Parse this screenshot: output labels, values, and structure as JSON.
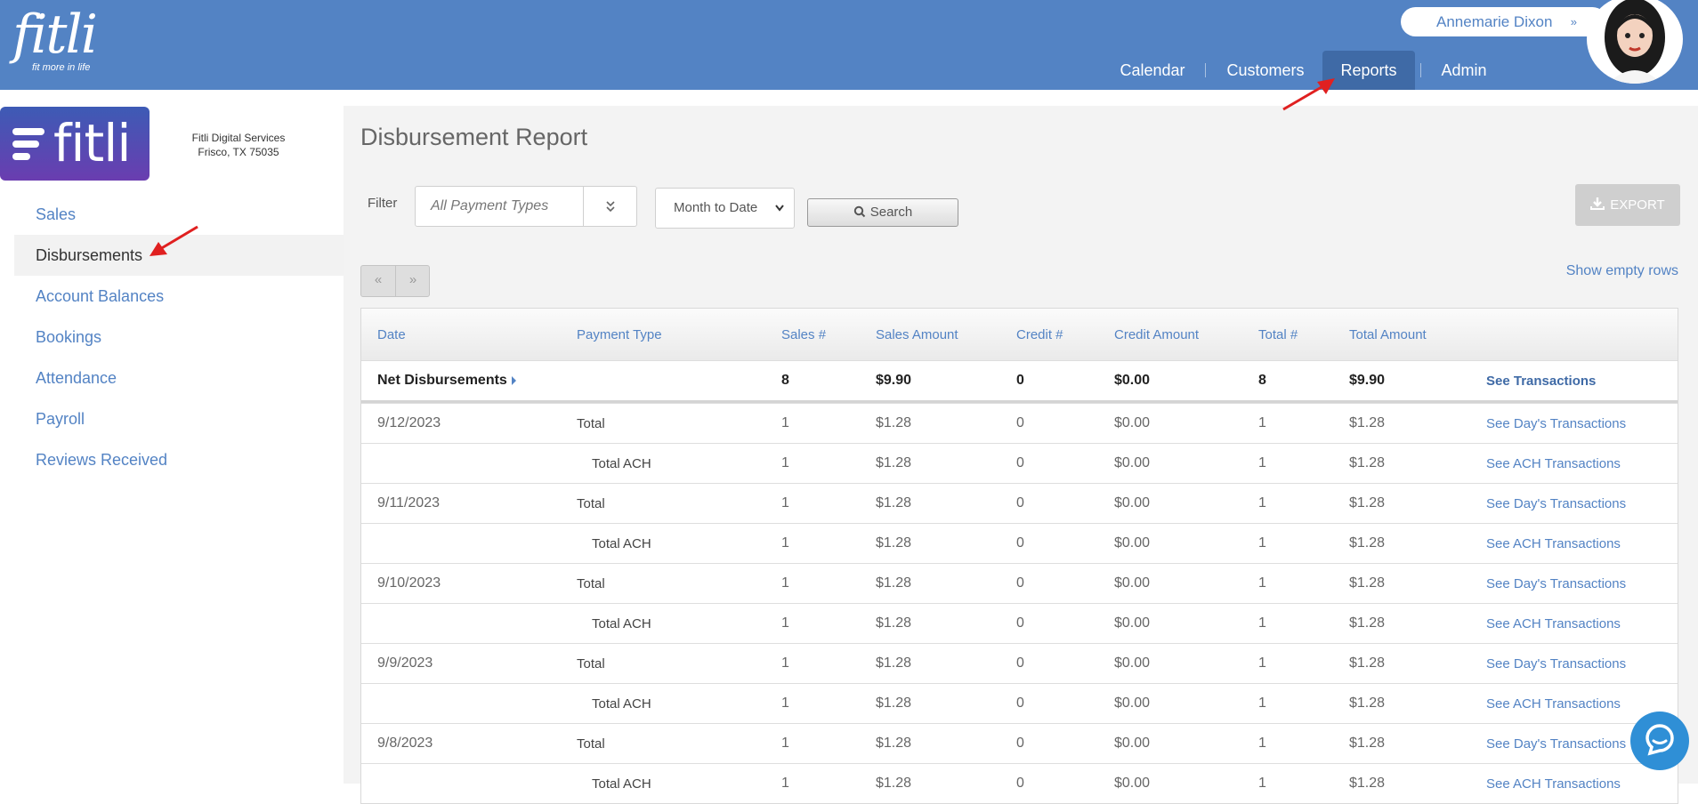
{
  "header": {
    "brand": "fitli",
    "tagline": "fit more in life",
    "user_name": "Annemarie Dixon",
    "user_chevron": "»",
    "nav": [
      {
        "label": "Calendar"
      },
      {
        "label": "Customers"
      },
      {
        "label": "Reports"
      },
      {
        "label": "Admin"
      }
    ],
    "active_nav": "Reports",
    "accent_color": "#5383c4"
  },
  "sidebar": {
    "logo_text": "fitli",
    "company_name": "Fitli Digital Services",
    "company_location": "Frisco, TX 75035",
    "items": [
      {
        "label": "Sales"
      },
      {
        "label": "Disbursements"
      },
      {
        "label": "Account Balances"
      },
      {
        "label": "Bookings"
      },
      {
        "label": "Attendance"
      },
      {
        "label": "Payroll"
      },
      {
        "label": "Reviews Received"
      }
    ],
    "active_item": "Disbursements"
  },
  "main": {
    "title": "Disbursement Report",
    "filter_label": "Filter",
    "payment_type_placeholder": "All Payment Types",
    "date_range": "Month to Date",
    "search_label": "Search",
    "export_label": "EXPORT",
    "pager_prev": "«",
    "pager_next": "»",
    "show_empty_rows": "Show empty rows"
  },
  "table": {
    "columns": [
      "Date",
      "Payment Type",
      "Sales #",
      "Sales Amount",
      "Credit #",
      "Credit Amount",
      "Total #",
      "Total Amount"
    ],
    "net": {
      "label": "Net Disbursements",
      "sales_count": "8",
      "sales_amount": "$9.90",
      "credit_count": "0",
      "credit_amount": "$0.00",
      "total_count": "8",
      "total_amount": "$9.90",
      "link": "See Transactions"
    },
    "rows": [
      {
        "date": "9/12/2023",
        "type": "Total",
        "sub": false,
        "sales": "1",
        "samt": "$1.28",
        "credit": "0",
        "camt": "$0.00",
        "total": "1",
        "tamt": "$1.28",
        "link": "See Day's Transactions"
      },
      {
        "date": "",
        "type": "Total ACH",
        "sub": true,
        "sales": "1",
        "samt": "$1.28",
        "credit": "0",
        "camt": "$0.00",
        "total": "1",
        "tamt": "$1.28",
        "link": "See ACH Transactions"
      },
      {
        "date": "9/11/2023",
        "type": "Total",
        "sub": false,
        "sales": "1",
        "samt": "$1.28",
        "credit": "0",
        "camt": "$0.00",
        "total": "1",
        "tamt": "$1.28",
        "link": "See Day's Transactions"
      },
      {
        "date": "",
        "type": "Total ACH",
        "sub": true,
        "sales": "1",
        "samt": "$1.28",
        "credit": "0",
        "camt": "$0.00",
        "total": "1",
        "tamt": "$1.28",
        "link": "See ACH Transactions"
      },
      {
        "date": "9/10/2023",
        "type": "Total",
        "sub": false,
        "sales": "1",
        "samt": "$1.28",
        "credit": "0",
        "camt": "$0.00",
        "total": "1",
        "tamt": "$1.28",
        "link": "See Day's Transactions"
      },
      {
        "date": "",
        "type": "Total ACH",
        "sub": true,
        "sales": "1",
        "samt": "$1.28",
        "credit": "0",
        "camt": "$0.00",
        "total": "1",
        "tamt": "$1.28",
        "link": "See ACH Transactions"
      },
      {
        "date": "9/9/2023",
        "type": "Total",
        "sub": false,
        "sales": "1",
        "samt": "$1.28",
        "credit": "0",
        "camt": "$0.00",
        "total": "1",
        "tamt": "$1.28",
        "link": "See Day's Transactions"
      },
      {
        "date": "",
        "type": "Total ACH",
        "sub": true,
        "sales": "1",
        "samt": "$1.28",
        "credit": "0",
        "camt": "$0.00",
        "total": "1",
        "tamt": "$1.28",
        "link": "See ACH Transactions"
      },
      {
        "date": "9/8/2023",
        "type": "Total",
        "sub": false,
        "sales": "1",
        "samt": "$1.28",
        "credit": "0",
        "camt": "$0.00",
        "total": "1",
        "tamt": "$1.28",
        "link": "See Day's Transactions"
      },
      {
        "date": "",
        "type": "Total ACH",
        "sub": true,
        "sales": "1",
        "samt": "$1.28",
        "credit": "0",
        "camt": "$0.00",
        "total": "1",
        "tamt": "$1.28",
        "link": "See ACH Transactions"
      }
    ]
  },
  "icons": {
    "search": "search-icon",
    "export": "download-icon",
    "chat": "chat-icon",
    "chevron": "double-chevron-down-icon"
  }
}
